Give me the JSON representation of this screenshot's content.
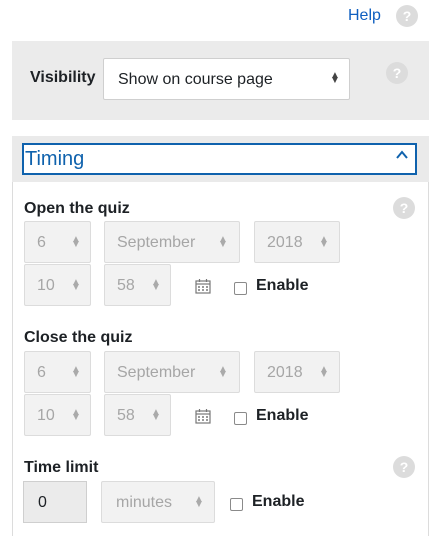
{
  "help": {
    "label": "Help",
    "icon": "question-circle-icon"
  },
  "visibility": {
    "label": "Visibility",
    "selected": "Show on course page"
  },
  "timing": {
    "title": "Timing",
    "open": {
      "label": "Open the quiz",
      "day": "6",
      "month": "September",
      "year": "2018",
      "hour": "10",
      "minute": "58",
      "enable_label": "Enable"
    },
    "close": {
      "label": "Close the quiz",
      "day": "6",
      "month": "September",
      "year": "2018",
      "hour": "10",
      "minute": "58",
      "enable_label": "Enable"
    },
    "time_limit": {
      "label": "Time limit",
      "value": "0",
      "unit": "minutes",
      "enable_label": "Enable"
    }
  },
  "question_mark": "?"
}
